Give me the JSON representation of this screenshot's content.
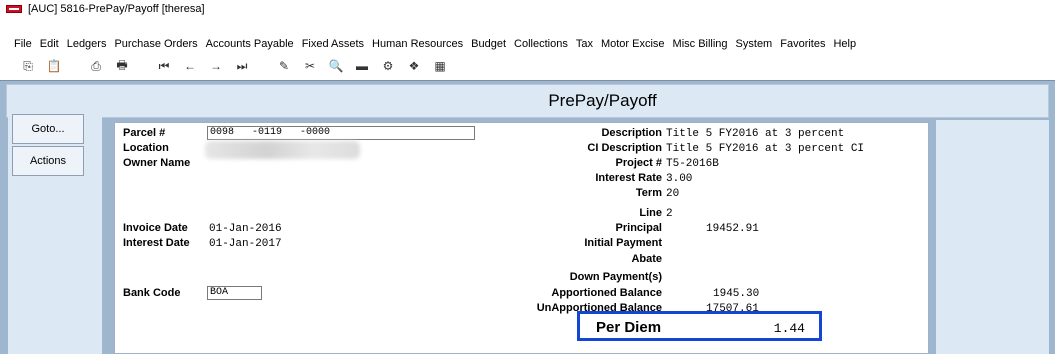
{
  "window": {
    "title": "[AUC] 5816-PrePay/Payoff [theresa]"
  },
  "menu": [
    "File",
    "Edit",
    "Ledgers",
    "Purchase Orders",
    "Accounts Payable",
    "Fixed Assets",
    "Human Resources",
    "Budget",
    "Collections",
    "Tax",
    "Motor Excise",
    "Misc Billing",
    "System",
    "Favorites",
    "Help"
  ],
  "toolbar": {
    "icons": [
      "copy-icon",
      "paste-icon",
      "print-icon",
      "print-preview-icon",
      "first-record-icon",
      "previous-record-icon",
      "next-record-icon",
      "last-record-icon",
      "edit-icon",
      "clear-icon",
      "search-icon",
      "save-icon",
      "settings-icon",
      "report-icon",
      "chart-icon"
    ],
    "glyphs": [
      "⎘",
      "📋",
      "⎙",
      "🖶",
      "⏮",
      "←",
      "→",
      "⏭",
      "✎",
      "✂",
      "🔍",
      "▬",
      "⚙",
      "❖",
      "▦"
    ]
  },
  "screen": {
    "title": "PrePay/Payoff"
  },
  "sidebar": {
    "goto": "Goto...",
    "actions": "Actions"
  },
  "left": {
    "parcel_label": "Parcel #",
    "parcel_value": "0098   -0119   -0000",
    "location_label": "Location",
    "owner_label": "Owner Name",
    "invoice_date_label": "Invoice Date",
    "invoice_date": "01-Jan-2016",
    "interest_date_label": "Interest Date",
    "interest_date": "01-Jan-2017",
    "bank_code_label": "Bank Code",
    "bank_code": "BOA"
  },
  "right": {
    "description_label": "Description",
    "description": "Title 5 FY2016 at 3 percent",
    "ci_description_label": "CI Description",
    "ci_description": "Title 5 FY2016 at 3 percent CI",
    "project_label": "Project #",
    "project": "T5-2016B",
    "interest_rate_label": "Interest Rate",
    "interest_rate": "3.00",
    "term_label": "Term",
    "term": "20",
    "line_label": "Line",
    "line": "2",
    "principal_label": "Principal",
    "principal": "19452.91",
    "initial_payment_label": "Initial Payment",
    "abate_label": "Abate",
    "down_payments_label": "Down Payment(s)",
    "apportioned_balance_label": "Apportioned Balance",
    "apportioned_balance": "1945.30",
    "unapportioned_balance_label": "UnApportioned Balance",
    "unapportioned_balance": "17507.61"
  },
  "per_diem": {
    "label": "Per Diem",
    "value": "1.44"
  },
  "colors": {
    "workspace": "#9fb6cf",
    "panel_band": "#dce9f5",
    "highlight": "#1446d6"
  }
}
